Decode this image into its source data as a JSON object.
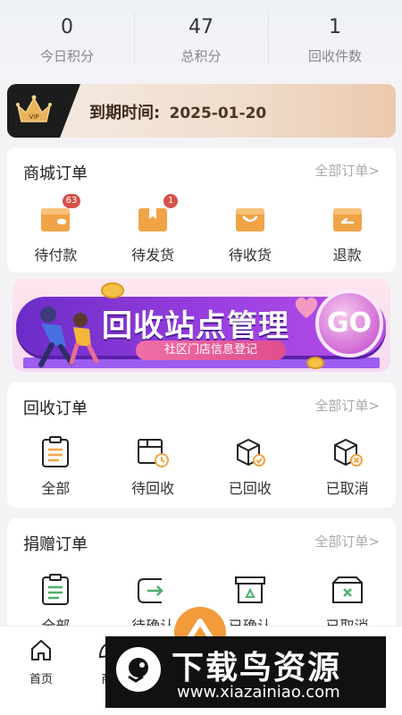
{
  "stats": [
    {
      "value": "0",
      "label": "今日积分"
    },
    {
      "value": "47",
      "label": "总积分"
    },
    {
      "value": "1",
      "label": "回收件数"
    }
  ],
  "vip": {
    "badge_text": "VIP",
    "label": "到期时间:",
    "date": "2025-01-20"
  },
  "mall_orders": {
    "title": "商城订单",
    "more": "全部订单>",
    "items": [
      {
        "label": "待付款",
        "badge": "63",
        "icon": "wallet-icon"
      },
      {
        "label": "待发货",
        "badge": "1",
        "icon": "package-icon"
      },
      {
        "label": "待收货",
        "badge": "",
        "icon": "shopping-bag-icon"
      },
      {
        "label": "退款",
        "badge": "",
        "icon": "refund-icon"
      }
    ]
  },
  "promo": {
    "title": "回收站点管理",
    "subtitle": "社区门店信息登记",
    "go": "GO"
  },
  "recycle_orders": {
    "title": "回收订单",
    "more": "全部订单>",
    "items": [
      {
        "label": "全部",
        "icon": "clipboard-icon"
      },
      {
        "label": "待回收",
        "icon": "box-clock-icon"
      },
      {
        "label": "已回收",
        "icon": "box-check-icon"
      },
      {
        "label": "已取消",
        "icon": "box-cancel-icon"
      }
    ]
  },
  "donation_orders": {
    "title": "捐赠订单",
    "more": "全部订单>",
    "items": [
      {
        "label": "全部",
        "icon": "clipboard-icon"
      },
      {
        "label": "待确认",
        "icon": "transfer-icon"
      },
      {
        "label": "已确认",
        "icon": "recycle-box-icon"
      },
      {
        "label": "已取消",
        "icon": "box-x-icon"
      }
    ]
  },
  "tabbar": {
    "home": "首页",
    "second": "商"
  },
  "watermark": {
    "title": "下载鸟资源",
    "url": "www.xiazainiao.com"
  },
  "colors": {
    "accent": "#f0a447",
    "badge": "#d6524a",
    "promo_purple": "#8a36d6"
  }
}
